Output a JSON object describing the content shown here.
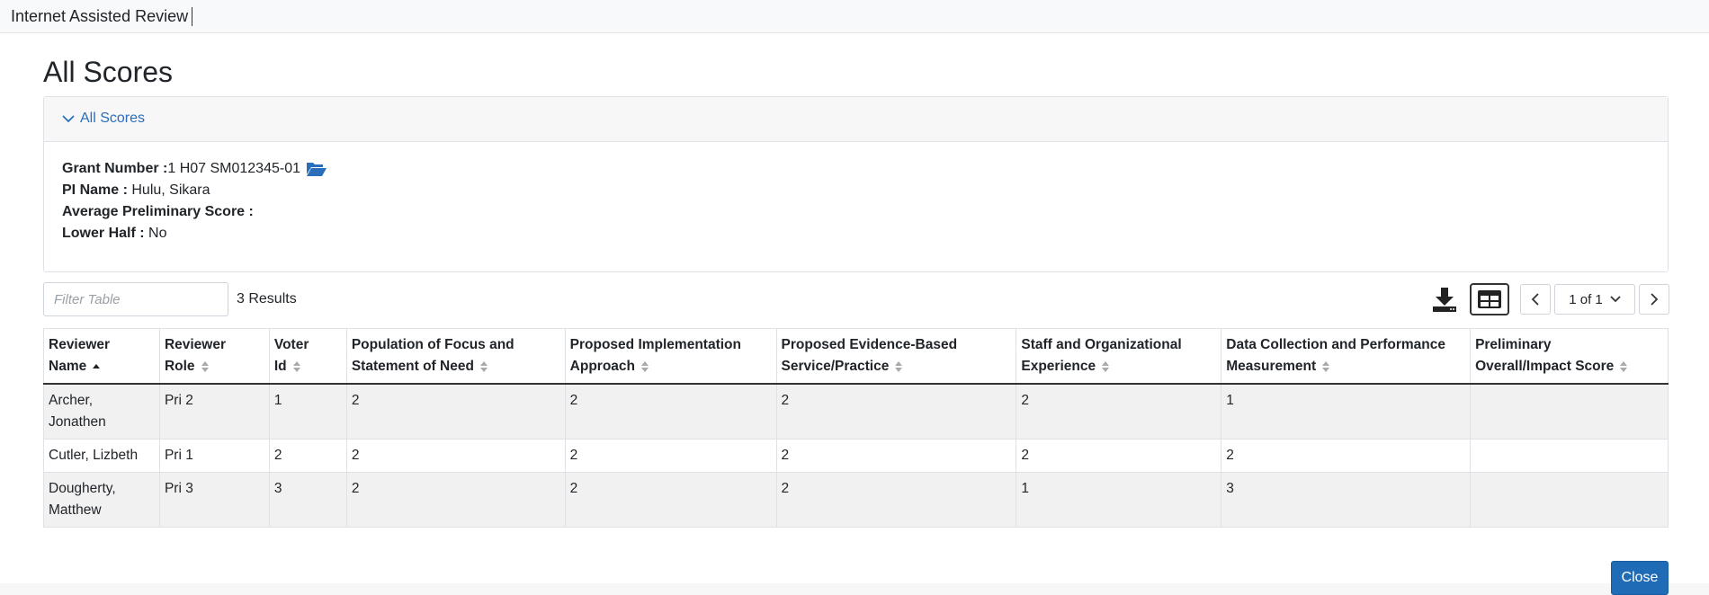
{
  "app": {
    "title": "Internet Assisted Review"
  },
  "page": {
    "title": "All Scores"
  },
  "panel": {
    "toggle_label": "All Scores",
    "grant_number_label": "Grant Number :",
    "grant_number_value": "1 H07 SM012345-01",
    "pi_name_label": "PI Name :",
    "pi_name_value": "Hulu, Sikara",
    "avg_score_label": "Average Preliminary Score :",
    "avg_score_value": "",
    "lower_half_label": "Lower Half :",
    "lower_half_value": "No"
  },
  "toolbar": {
    "filter_placeholder": "Filter Table",
    "results_text": "3 Results",
    "page_indicator": "1 of 1"
  },
  "table": {
    "columns": [
      {
        "line1": "Reviewer",
        "line2": "Name",
        "sort": "asc"
      },
      {
        "line1": "Reviewer",
        "line2": "Role",
        "sort": "both"
      },
      {
        "line1": "Voter",
        "line2": "Id",
        "sort": "both"
      },
      {
        "line1": "Population of Focus and",
        "line2": "Statement of Need",
        "sort": "both"
      },
      {
        "line1": "Proposed Implementation",
        "line2": "Approach",
        "sort": "both"
      },
      {
        "line1": "Proposed Evidence-Based",
        "line2": "Service/Practice",
        "sort": "both"
      },
      {
        "line1": "Staff and Organizational",
        "line2": "Experience",
        "sort": "both"
      },
      {
        "line1": "Data Collection and Performance",
        "line2": "Measurement",
        "sort": "both"
      },
      {
        "line1": "Preliminary",
        "line2": "Overall/Impact Score",
        "sort": "both"
      }
    ],
    "rows": [
      {
        "name_line1": "Archer,",
        "name_line2": "Jonathen",
        "role": "Pri 2",
        "voter_id": "1",
        "population": "2",
        "implementation": "2",
        "evidence": "2",
        "staff": "2",
        "data_collection": "1",
        "overall": ""
      },
      {
        "name_line1": "Cutler, Lizbeth",
        "name_line2": "",
        "role": "Pri 1",
        "voter_id": "2",
        "population": "2",
        "implementation": "2",
        "evidence": "2",
        "staff": "2",
        "data_collection": "2",
        "overall": ""
      },
      {
        "name_line1": "Dougherty,",
        "name_line2": "Matthew",
        "role": "Pri 3",
        "voter_id": "3",
        "population": "2",
        "implementation": "2",
        "evidence": "2",
        "staff": "1",
        "data_collection": "3",
        "overall": ""
      }
    ]
  },
  "footer": {
    "close_label": "Close"
  },
  "colors": {
    "accent": "#1f6bb5",
    "link": "#2a6ebb",
    "row_stripe": "#f1f1f1"
  },
  "icons": {
    "toggle": "chevron-down-icon",
    "grant": "folder-open-icon",
    "download": "download-icon",
    "grid": "table-view-icon",
    "prev": "chevron-left-icon",
    "next": "chevron-right-icon",
    "sort": "sort-icon"
  }
}
